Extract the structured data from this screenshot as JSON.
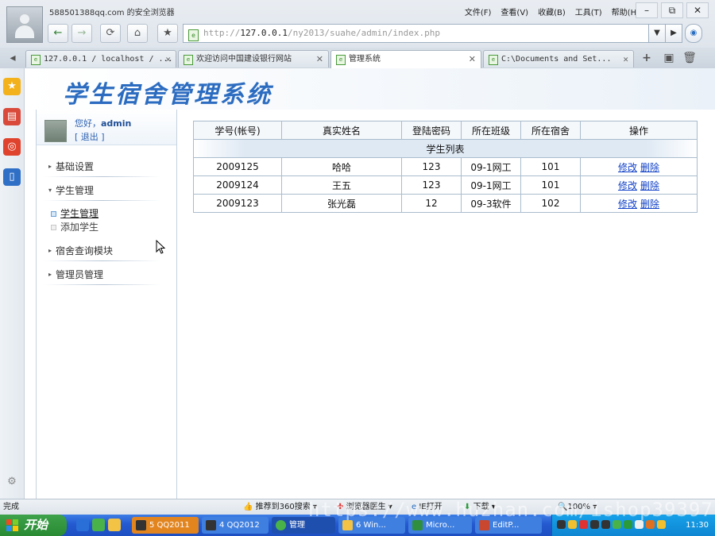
{
  "window": {
    "title": "588501388qq.com 的安全浏览器",
    "menu": [
      "文件(F)",
      "查看(V)",
      "收藏(B)",
      "工具(T)",
      "帮助(H)"
    ],
    "controls": [
      "–",
      "⧉",
      "✕"
    ]
  },
  "toolbar": {
    "back": "←",
    "forward": "→",
    "refresh": "⟳",
    "home": "⌂",
    "favorite": "★",
    "url_prefix": "http://",
    "url_host": "127.0.0.1",
    "url_path": "/ny2013/suahe/admin/index.php"
  },
  "tabs": [
    {
      "label": "127.0.0.1 / localhost / ...",
      "mono": true
    },
    {
      "label": "欢迎访问中国建设银行网站",
      "mono": false
    },
    {
      "label": "管理系统",
      "mono": false,
      "active": true
    },
    {
      "label": "C:\\Documents and Set...",
      "mono": true
    }
  ],
  "app": {
    "logo_title": "学生宿舍管理系统",
    "user": {
      "greeting": "您好，",
      "name": "admin",
      "logout": "[ 退出 ]"
    },
    "menu": [
      {
        "label": "基础设置",
        "expanded": false
      },
      {
        "label": "学生管理",
        "expanded": true,
        "subitems": [
          {
            "label": "学生管理",
            "active": true
          },
          {
            "label": "添加学生",
            "active": false
          }
        ]
      },
      {
        "label": "宿舍查询模块",
        "expanded": false
      },
      {
        "label": "管理员管理",
        "expanded": false
      }
    ]
  },
  "student_list": {
    "caption": "学生列表",
    "headers": [
      "学号(帐号)",
      "真实姓名",
      "登陆密码",
      "所在班级",
      "所在宿舍",
      "操作"
    ],
    "edit_label": "修改",
    "delete_label": "删除",
    "rows": [
      [
        "2009125",
        "哈哈",
        "123",
        "09-1网工",
        "101"
      ],
      [
        "2009124",
        "王五",
        "123",
        "09-1网工",
        "101"
      ],
      [
        "2009123",
        "张光磊",
        "12",
        "09-3软件",
        "102"
      ]
    ]
  },
  "statusbar": {
    "left": "完成",
    "items": [
      "推荐到360搜索",
      "浏览器医生",
      "IE打开",
      "下载",
      "100%"
    ]
  },
  "taskbar": {
    "start": "开始",
    "buttons": [
      "5 QQ2011",
      "4 QQ2012",
      "管理",
      "6 Win...",
      "Micro...",
      "EditP..."
    ],
    "clock": "11:30"
  },
  "watermark": "https://www.huzhan.com/ishop39397"
}
